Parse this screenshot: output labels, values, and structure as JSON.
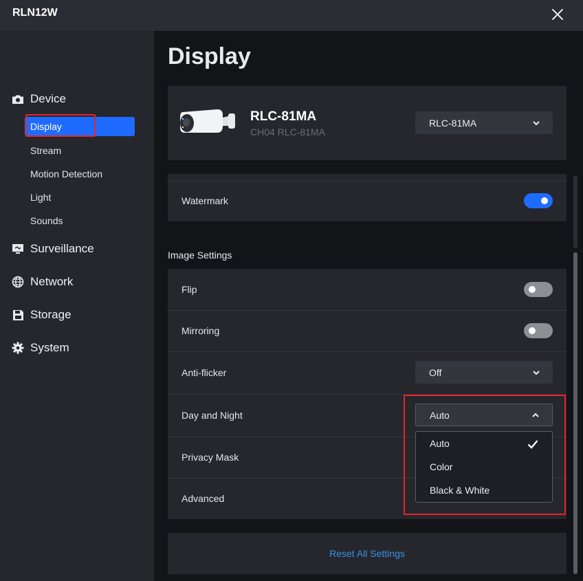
{
  "window": {
    "title": "RLN12W"
  },
  "sidebar": {
    "categories": [
      {
        "label": "Device",
        "icon": "camera-icon"
      },
      {
        "label": "Surveillance",
        "icon": "monitor-icon"
      },
      {
        "label": "Network",
        "icon": "globe-icon"
      },
      {
        "label": "Storage",
        "icon": "floppy-icon"
      },
      {
        "label": "System",
        "icon": "gear-icon"
      }
    ],
    "device_items": [
      "Display",
      "Stream",
      "Motion Detection",
      "Light",
      "Sounds"
    ],
    "active_item": "Display"
  },
  "page": {
    "title": "Display"
  },
  "device": {
    "name": "RLC-81MA",
    "subtitle": "CH04 RLC-81MA",
    "selector_value": "RLC-81MA"
  },
  "watermark": {
    "label": "Watermark",
    "enabled": true
  },
  "image_settings": {
    "heading": "Image Settings",
    "flip": {
      "label": "Flip",
      "enabled": false
    },
    "mirroring": {
      "label": "Mirroring",
      "enabled": false
    },
    "anti_flicker": {
      "label": "Anti-flicker",
      "value": "Off"
    },
    "day_night": {
      "label": "Day and Night",
      "value": "Auto",
      "options": [
        "Auto",
        "Color",
        "Black & White"
      ],
      "selected": "Auto"
    },
    "privacy_mask": {
      "label": "Privacy Mask"
    },
    "advanced": {
      "label": "Advanced"
    }
  },
  "reset": {
    "label": "Reset All Settings"
  },
  "colors": {
    "accent": "#1f6bff",
    "highlight": "#e5252a",
    "link": "#3d8fe8"
  }
}
